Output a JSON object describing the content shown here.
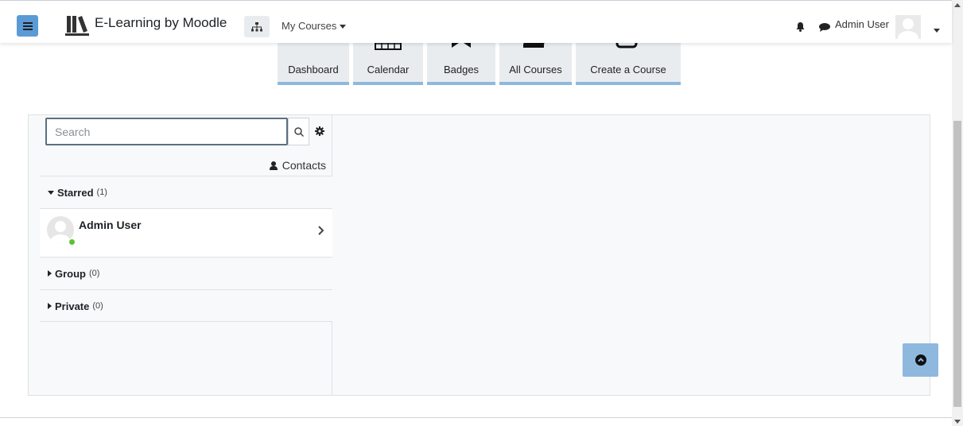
{
  "navbar": {
    "site_name": "E-Learning by Moodle",
    "my_courses": "My Courses",
    "user_name": "Admin User"
  },
  "quick_links": [
    {
      "label": "Dashboard",
      "icon": "home-icon"
    },
    {
      "label": "Calendar",
      "icon": "calendar-icon"
    },
    {
      "label": "Badges",
      "icon": "bookmark-icon"
    },
    {
      "label": "All Courses",
      "icon": "book-icon"
    },
    {
      "label": "Create a Course",
      "icon": "edit-icon"
    }
  ],
  "messaging": {
    "search_placeholder": "Search",
    "contacts_label": "Contacts",
    "sections": {
      "starred": {
        "label": "Starred",
        "count": "(1)"
      },
      "group": {
        "label": "Group",
        "count": "(0)"
      },
      "private": {
        "label": "Private",
        "count": "(0)"
      }
    },
    "conversation": {
      "name": "Admin User",
      "status": "online"
    }
  },
  "colors": {
    "accent": "#8fb8de",
    "primary": "#5b9bd5",
    "online": "#5bc236"
  }
}
